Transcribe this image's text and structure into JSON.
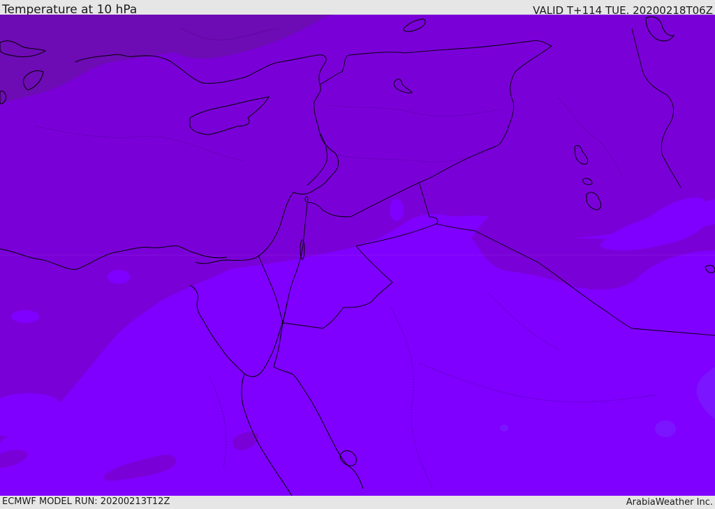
{
  "header": {
    "title": "Temperature at 10 hPa",
    "valid_time": "VALID T+114 TUE. 20200218T06Z"
  },
  "footer": {
    "model_run": "ECMWF MODEL RUN: 20200213T12Z",
    "credit": "ArabiaWeather Inc."
  },
  "colors": {
    "band_coldest": "#6d0bb4",
    "band_cold": "#7a00d8",
    "band_mid": "#7e00f2",
    "band_warm": "#7f00fe",
    "band_warmest": "#7b14ff",
    "coastline": "#000000",
    "border": "#000000"
  }
}
